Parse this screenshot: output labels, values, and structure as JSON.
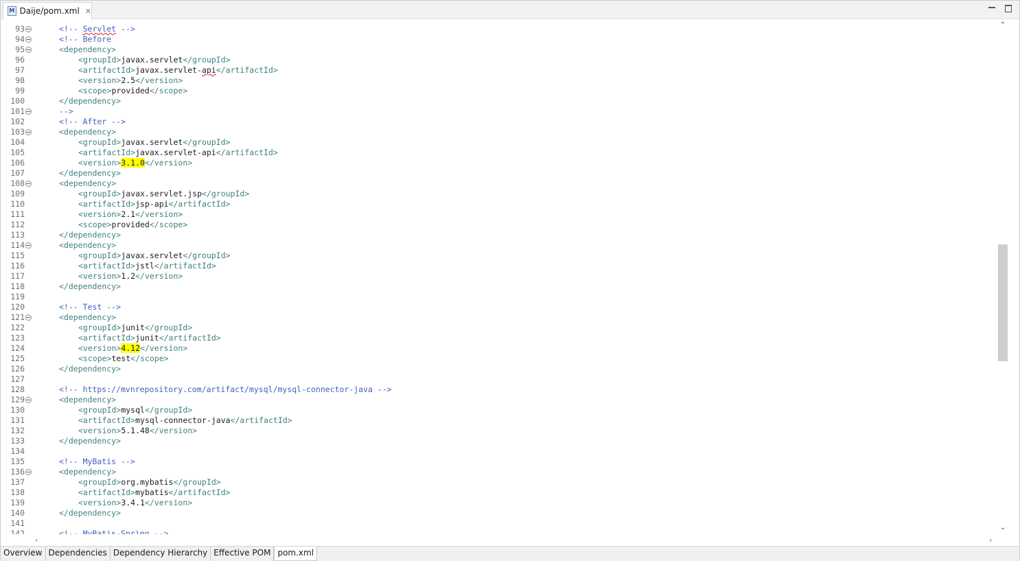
{
  "editor_tab": {
    "title": "Daije/pom.xml",
    "close": "✕"
  },
  "page_tabs": [
    "Overview",
    "Dependencies",
    "Dependency Hierarchy",
    "Effective POM",
    "pom.xml"
  ],
  "active_page_tab": "pom.xml",
  "lines": [
    {
      "n": "93",
      "fold": true,
      "indent": 2,
      "seg": [
        [
          "c",
          "<!-- "
        ],
        [
          "s",
          "Servlet"
        ],
        [
          "c",
          " -->"
        ]
      ]
    },
    {
      "n": "94",
      "fold": true,
      "indent": 2,
      "seg": [
        [
          "c",
          "<!-- Before"
        ]
      ]
    },
    {
      "n": "95",
      "fold": true,
      "indent": 2,
      "seg": [
        [
          "t",
          "<dependency>"
        ]
      ]
    },
    {
      "n": "96",
      "indent": 4,
      "seg": [
        [
          "t",
          "<groupId>"
        ],
        [
          "x",
          "javax.servlet"
        ],
        [
          "t",
          "</groupId>"
        ]
      ]
    },
    {
      "n": "97",
      "indent": 4,
      "seg": [
        [
          "t",
          "<artifactId>"
        ],
        [
          "x",
          "javax.servlet-"
        ],
        [
          "s",
          "api"
        ],
        [
          "t",
          "</artifactId>"
        ]
      ]
    },
    {
      "n": "98",
      "indent": 4,
      "seg": [
        [
          "t",
          "<version>"
        ],
        [
          "x",
          "2.5"
        ],
        [
          "t",
          "</version>"
        ]
      ]
    },
    {
      "n": "99",
      "indent": 4,
      "seg": [
        [
          "t",
          "<scope>"
        ],
        [
          "x",
          "provided"
        ],
        [
          "t",
          "</scope>"
        ]
      ]
    },
    {
      "n": "100",
      "indent": 2,
      "seg": [
        [
          "t",
          "</dependency>"
        ]
      ]
    },
    {
      "n": "101",
      "fold": true,
      "indent": 2,
      "seg": [
        [
          "c",
          "-->"
        ]
      ]
    },
    {
      "n": "102",
      "indent": 2,
      "seg": [
        [
          "c",
          "<!-- After -->"
        ]
      ]
    },
    {
      "n": "103",
      "fold": true,
      "indent": 2,
      "seg": [
        [
          "t",
          "<dependency>"
        ]
      ]
    },
    {
      "n": "104",
      "indent": 4,
      "seg": [
        [
          "t",
          "<groupId>"
        ],
        [
          "x",
          "javax.servlet"
        ],
        [
          "t",
          "</groupId>"
        ]
      ]
    },
    {
      "n": "105",
      "indent": 4,
      "seg": [
        [
          "t",
          "<artifactId>"
        ],
        [
          "x",
          "javax.servlet-api"
        ],
        [
          "t",
          "</artifactId>"
        ]
      ]
    },
    {
      "n": "106",
      "indent": 4,
      "seg": [
        [
          "t",
          "<version>"
        ],
        [
          "h",
          "3.1.0"
        ],
        [
          "t",
          "</version>"
        ]
      ]
    },
    {
      "n": "107",
      "indent": 2,
      "seg": [
        [
          "t",
          "</dependency>"
        ]
      ]
    },
    {
      "n": "108",
      "fold": true,
      "indent": 2,
      "seg": [
        [
          "t",
          "<dependency>"
        ]
      ]
    },
    {
      "n": "109",
      "indent": 4,
      "seg": [
        [
          "t",
          "<groupId>"
        ],
        [
          "x",
          "javax.servlet.jsp"
        ],
        [
          "t",
          "</groupId>"
        ]
      ]
    },
    {
      "n": "110",
      "indent": 4,
      "seg": [
        [
          "t",
          "<artifactId>"
        ],
        [
          "x",
          "jsp-api"
        ],
        [
          "t",
          "</artifactId>"
        ]
      ]
    },
    {
      "n": "111",
      "indent": 4,
      "seg": [
        [
          "t",
          "<version>"
        ],
        [
          "x",
          "2.1"
        ],
        [
          "t",
          "</version>"
        ]
      ]
    },
    {
      "n": "112",
      "indent": 4,
      "seg": [
        [
          "t",
          "<scope>"
        ],
        [
          "x",
          "provided"
        ],
        [
          "t",
          "</scope>"
        ]
      ]
    },
    {
      "n": "113",
      "indent": 2,
      "seg": [
        [
          "t",
          "</dependency>"
        ]
      ]
    },
    {
      "n": "114",
      "fold": true,
      "indent": 2,
      "seg": [
        [
          "t",
          "<dependency>"
        ]
      ]
    },
    {
      "n": "115",
      "indent": 4,
      "seg": [
        [
          "t",
          "<groupId>"
        ],
        [
          "x",
          "javax.servlet"
        ],
        [
          "t",
          "</groupId>"
        ]
      ]
    },
    {
      "n": "116",
      "indent": 4,
      "seg": [
        [
          "t",
          "<artifactId>"
        ],
        [
          "x",
          "jstl"
        ],
        [
          "t",
          "</artifactId>"
        ]
      ]
    },
    {
      "n": "117",
      "indent": 4,
      "seg": [
        [
          "t",
          "<version>"
        ],
        [
          "x",
          "1.2"
        ],
        [
          "t",
          "</version>"
        ]
      ]
    },
    {
      "n": "118",
      "indent": 2,
      "seg": [
        [
          "t",
          "</dependency>"
        ]
      ]
    },
    {
      "n": "119",
      "indent": 0,
      "seg": []
    },
    {
      "n": "120",
      "indent": 2,
      "seg": [
        [
          "c",
          "<!-- Test -->"
        ]
      ]
    },
    {
      "n": "121",
      "fold": true,
      "indent": 2,
      "seg": [
        [
          "t",
          "<dependency>"
        ]
      ]
    },
    {
      "n": "122",
      "indent": 4,
      "seg": [
        [
          "t",
          "<groupId>"
        ],
        [
          "x",
          "junit"
        ],
        [
          "t",
          "</groupId>"
        ]
      ]
    },
    {
      "n": "123",
      "indent": 4,
      "seg": [
        [
          "t",
          "<artifactId>"
        ],
        [
          "x",
          "junit"
        ],
        [
          "t",
          "</artifactId>"
        ]
      ]
    },
    {
      "n": "124",
      "indent": 4,
      "seg": [
        [
          "t",
          "<version>"
        ],
        [
          "h",
          "4.12"
        ],
        [
          "t",
          "</version>"
        ]
      ]
    },
    {
      "n": "125",
      "indent": 4,
      "seg": [
        [
          "t",
          "<scope>"
        ],
        [
          "x",
          "test"
        ],
        [
          "t",
          "</scope>"
        ]
      ]
    },
    {
      "n": "126",
      "indent": 2,
      "seg": [
        [
          "t",
          "</dependency>"
        ]
      ]
    },
    {
      "n": "127",
      "indent": 0,
      "seg": []
    },
    {
      "n": "128",
      "indent": 2,
      "seg": [
        [
          "c",
          "<!-- https://mvnrepository.com/artifact/mysql/mysql-connector-java -->"
        ]
      ]
    },
    {
      "n": "129",
      "fold": true,
      "indent": 2,
      "seg": [
        [
          "t",
          "<dependency>"
        ]
      ]
    },
    {
      "n": "130",
      "indent": 4,
      "seg": [
        [
          "t",
          "<groupId>"
        ],
        [
          "x",
          "mysql"
        ],
        [
          "t",
          "</groupId>"
        ]
      ]
    },
    {
      "n": "131",
      "indent": 4,
      "seg": [
        [
          "t",
          "<artifactId>"
        ],
        [
          "x",
          "mysql-connector-java"
        ],
        [
          "t",
          "</artifactId>"
        ]
      ]
    },
    {
      "n": "132",
      "indent": 4,
      "seg": [
        [
          "t",
          "<version>"
        ],
        [
          "x",
          "5.1.48"
        ],
        [
          "t",
          "</version>"
        ]
      ]
    },
    {
      "n": "133",
      "indent": 2,
      "seg": [
        [
          "t",
          "</dependency>"
        ]
      ]
    },
    {
      "n": "134",
      "indent": 0,
      "seg": []
    },
    {
      "n": "135",
      "indent": 2,
      "seg": [
        [
          "c",
          "<!-- MyBatis -->"
        ]
      ]
    },
    {
      "n": "136",
      "fold": true,
      "indent": 2,
      "seg": [
        [
          "t",
          "<dependency>"
        ]
      ]
    },
    {
      "n": "137",
      "indent": 4,
      "seg": [
        [
          "t",
          "<groupId>"
        ],
        [
          "x",
          "org.mybatis"
        ],
        [
          "t",
          "</groupId>"
        ]
      ]
    },
    {
      "n": "138",
      "indent": 4,
      "seg": [
        [
          "t",
          "<artifactId>"
        ],
        [
          "x",
          "mybatis"
        ],
        [
          "t",
          "</artifactId>"
        ]
      ]
    },
    {
      "n": "139",
      "indent": 4,
      "seg": [
        [
          "t",
          "<version>"
        ],
        [
          "x",
          "3.4.1"
        ],
        [
          "t",
          "</version>"
        ]
      ]
    },
    {
      "n": "140",
      "indent": 2,
      "seg": [
        [
          "t",
          "</dependency>"
        ]
      ]
    },
    {
      "n": "141",
      "indent": 0,
      "seg": []
    },
    {
      "n": "142",
      "indent": 2,
      "seg": [
        [
          "c",
          "<!-- MyBatis-Spring -->"
        ]
      ]
    }
  ],
  "colors": {
    "tag": "#3f7f7f",
    "comment": "#3f5fbf",
    "text": "#1e1e1e",
    "highlight": "#ffff00",
    "line_number": "#6f6f6f"
  },
  "icons": {
    "file": "maven-pom-icon",
    "close": "close-icon",
    "minimize": "minimize-icon",
    "maximize": "maximize-icon"
  }
}
